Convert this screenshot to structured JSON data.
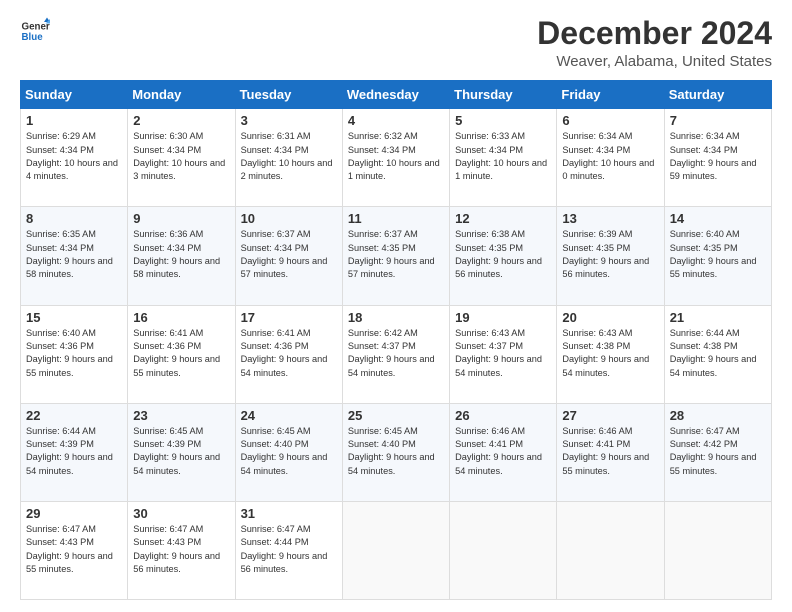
{
  "header": {
    "logo_line1": "General",
    "logo_line2": "Blue",
    "title": "December 2024",
    "subtitle": "Weaver, Alabama, United States"
  },
  "calendar": {
    "columns": [
      "Sunday",
      "Monday",
      "Tuesday",
      "Wednesday",
      "Thursday",
      "Friday",
      "Saturday"
    ],
    "rows": [
      [
        {
          "day": "1",
          "info": "Sunrise: 6:29 AM\nSunset: 4:34 PM\nDaylight: 10 hours\nand 4 minutes."
        },
        {
          "day": "2",
          "info": "Sunrise: 6:30 AM\nSunset: 4:34 PM\nDaylight: 10 hours\nand 3 minutes."
        },
        {
          "day": "3",
          "info": "Sunrise: 6:31 AM\nSunset: 4:34 PM\nDaylight: 10 hours\nand 2 minutes."
        },
        {
          "day": "4",
          "info": "Sunrise: 6:32 AM\nSunset: 4:34 PM\nDaylight: 10 hours\nand 1 minute."
        },
        {
          "day": "5",
          "info": "Sunrise: 6:33 AM\nSunset: 4:34 PM\nDaylight: 10 hours\nand 1 minute."
        },
        {
          "day": "6",
          "info": "Sunrise: 6:34 AM\nSunset: 4:34 PM\nDaylight: 10 hours\nand 0 minutes."
        },
        {
          "day": "7",
          "info": "Sunrise: 6:34 AM\nSunset: 4:34 PM\nDaylight: 9 hours\nand 59 minutes."
        }
      ],
      [
        {
          "day": "8",
          "info": "Sunrise: 6:35 AM\nSunset: 4:34 PM\nDaylight: 9 hours\nand 58 minutes."
        },
        {
          "day": "9",
          "info": "Sunrise: 6:36 AM\nSunset: 4:34 PM\nDaylight: 9 hours\nand 58 minutes."
        },
        {
          "day": "10",
          "info": "Sunrise: 6:37 AM\nSunset: 4:34 PM\nDaylight: 9 hours\nand 57 minutes."
        },
        {
          "day": "11",
          "info": "Sunrise: 6:37 AM\nSunset: 4:35 PM\nDaylight: 9 hours\nand 57 minutes."
        },
        {
          "day": "12",
          "info": "Sunrise: 6:38 AM\nSunset: 4:35 PM\nDaylight: 9 hours\nand 56 minutes."
        },
        {
          "day": "13",
          "info": "Sunrise: 6:39 AM\nSunset: 4:35 PM\nDaylight: 9 hours\nand 56 minutes."
        },
        {
          "day": "14",
          "info": "Sunrise: 6:40 AM\nSunset: 4:35 PM\nDaylight: 9 hours\nand 55 minutes."
        }
      ],
      [
        {
          "day": "15",
          "info": "Sunrise: 6:40 AM\nSunset: 4:36 PM\nDaylight: 9 hours\nand 55 minutes."
        },
        {
          "day": "16",
          "info": "Sunrise: 6:41 AM\nSunset: 4:36 PM\nDaylight: 9 hours\nand 55 minutes."
        },
        {
          "day": "17",
          "info": "Sunrise: 6:41 AM\nSunset: 4:36 PM\nDaylight: 9 hours\nand 54 minutes."
        },
        {
          "day": "18",
          "info": "Sunrise: 6:42 AM\nSunset: 4:37 PM\nDaylight: 9 hours\nand 54 minutes."
        },
        {
          "day": "19",
          "info": "Sunrise: 6:43 AM\nSunset: 4:37 PM\nDaylight: 9 hours\nand 54 minutes."
        },
        {
          "day": "20",
          "info": "Sunrise: 6:43 AM\nSunset: 4:38 PM\nDaylight: 9 hours\nand 54 minutes."
        },
        {
          "day": "21",
          "info": "Sunrise: 6:44 AM\nSunset: 4:38 PM\nDaylight: 9 hours\nand 54 minutes."
        }
      ],
      [
        {
          "day": "22",
          "info": "Sunrise: 6:44 AM\nSunset: 4:39 PM\nDaylight: 9 hours\nand 54 minutes."
        },
        {
          "day": "23",
          "info": "Sunrise: 6:45 AM\nSunset: 4:39 PM\nDaylight: 9 hours\nand 54 minutes."
        },
        {
          "day": "24",
          "info": "Sunrise: 6:45 AM\nSunset: 4:40 PM\nDaylight: 9 hours\nand 54 minutes."
        },
        {
          "day": "25",
          "info": "Sunrise: 6:45 AM\nSunset: 4:40 PM\nDaylight: 9 hours\nand 54 minutes."
        },
        {
          "day": "26",
          "info": "Sunrise: 6:46 AM\nSunset: 4:41 PM\nDaylight: 9 hours\nand 54 minutes."
        },
        {
          "day": "27",
          "info": "Sunrise: 6:46 AM\nSunset: 4:41 PM\nDaylight: 9 hours\nand 55 minutes."
        },
        {
          "day": "28",
          "info": "Sunrise: 6:47 AM\nSunset: 4:42 PM\nDaylight: 9 hours\nand 55 minutes."
        }
      ],
      [
        {
          "day": "29",
          "info": "Sunrise: 6:47 AM\nSunset: 4:43 PM\nDaylight: 9 hours\nand 55 minutes."
        },
        {
          "day": "30",
          "info": "Sunrise: 6:47 AM\nSunset: 4:43 PM\nDaylight: 9 hours\nand 56 minutes."
        },
        {
          "day": "31",
          "info": "Sunrise: 6:47 AM\nSunset: 4:44 PM\nDaylight: 9 hours\nand 56 minutes."
        },
        {
          "day": "",
          "info": ""
        },
        {
          "day": "",
          "info": ""
        },
        {
          "day": "",
          "info": ""
        },
        {
          "day": "",
          "info": ""
        }
      ]
    ]
  }
}
